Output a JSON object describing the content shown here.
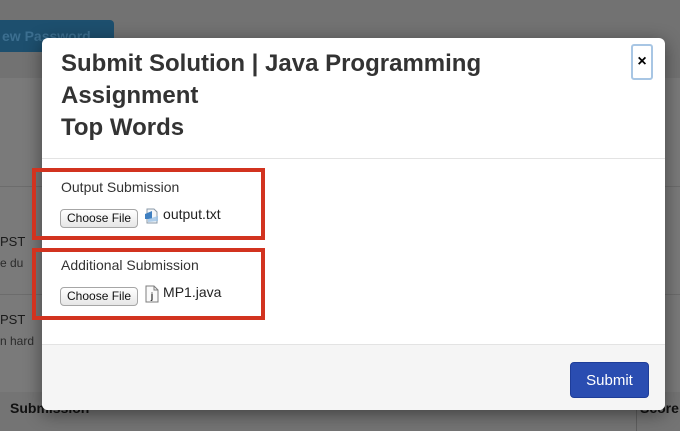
{
  "background": {
    "top_button_fragment": "ew Password",
    "row_fragments": [
      {
        "text": "PST",
        "small": false
      },
      {
        "text": "e du",
        "small": true
      },
      {
        "text": "PST",
        "small": false
      },
      {
        "text": "n hard",
        "small": true
      }
    ],
    "table_header": {
      "left": "Submission",
      "right": "Score"
    }
  },
  "modal": {
    "title_lines": [
      "Submit Solution | Java Programming",
      "Assignment",
      "Top Words"
    ],
    "close_label": "×",
    "fields": [
      {
        "label": "Output Submission",
        "button_label": "Choose File",
        "file_name": "output.txt",
        "icon": "text-file-icon"
      },
      {
        "label": "Additional Submission",
        "button_label": "Choose File",
        "file_name": "MP1.java",
        "icon": "java-file-icon"
      }
    ],
    "submit_label": "Submit"
  },
  "colors": {
    "highlight": "#d2331f",
    "submit": "#2a4db1"
  }
}
